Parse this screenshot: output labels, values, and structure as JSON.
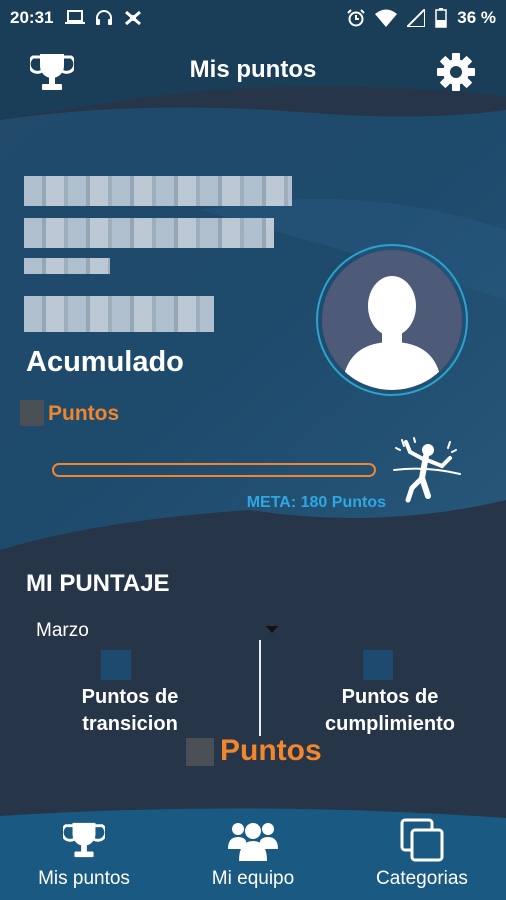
{
  "status_bar": {
    "time": "20:31",
    "battery": "36 %",
    "left_icons": [
      "laptop-icon",
      "headset-icon",
      "tool-icon"
    ],
    "right_icons": [
      "alarm-icon",
      "wifi-icon",
      "signal-icon",
      "battery-icon"
    ]
  },
  "header": {
    "title": "Mis puntos",
    "left_icon": "trophy-icon",
    "right_icon": "gear-icon"
  },
  "profile": {
    "title": "Acumulado",
    "points_label": "Puntos",
    "progress": 0,
    "meta": "META: 180 Puntos",
    "avatar_icon": "user-silhouette-icon",
    "goal_icon": "runner-finish-icon"
  },
  "mi_puntaje": {
    "title": "MI PUNTAJE",
    "month": "Marzo",
    "col1_label_line1": "Puntos de",
    "col1_label_line2": "transicion",
    "col2_label_line1": "Puntos de",
    "col2_label_line2": "cumplimiento",
    "total_label": "Puntos"
  },
  "bottom_nav": {
    "items": [
      {
        "label": "Mis puntos",
        "icon": "trophy-icon"
      },
      {
        "label": "Mi equipo",
        "icon": "team-icon"
      },
      {
        "label": "Categorias",
        "icon": "categories-icon"
      }
    ]
  },
  "colors": {
    "background": "#263548",
    "header": "#1a3e58",
    "accent_orange": "#f0862d",
    "accent_blue": "#2fa7e0"
  }
}
